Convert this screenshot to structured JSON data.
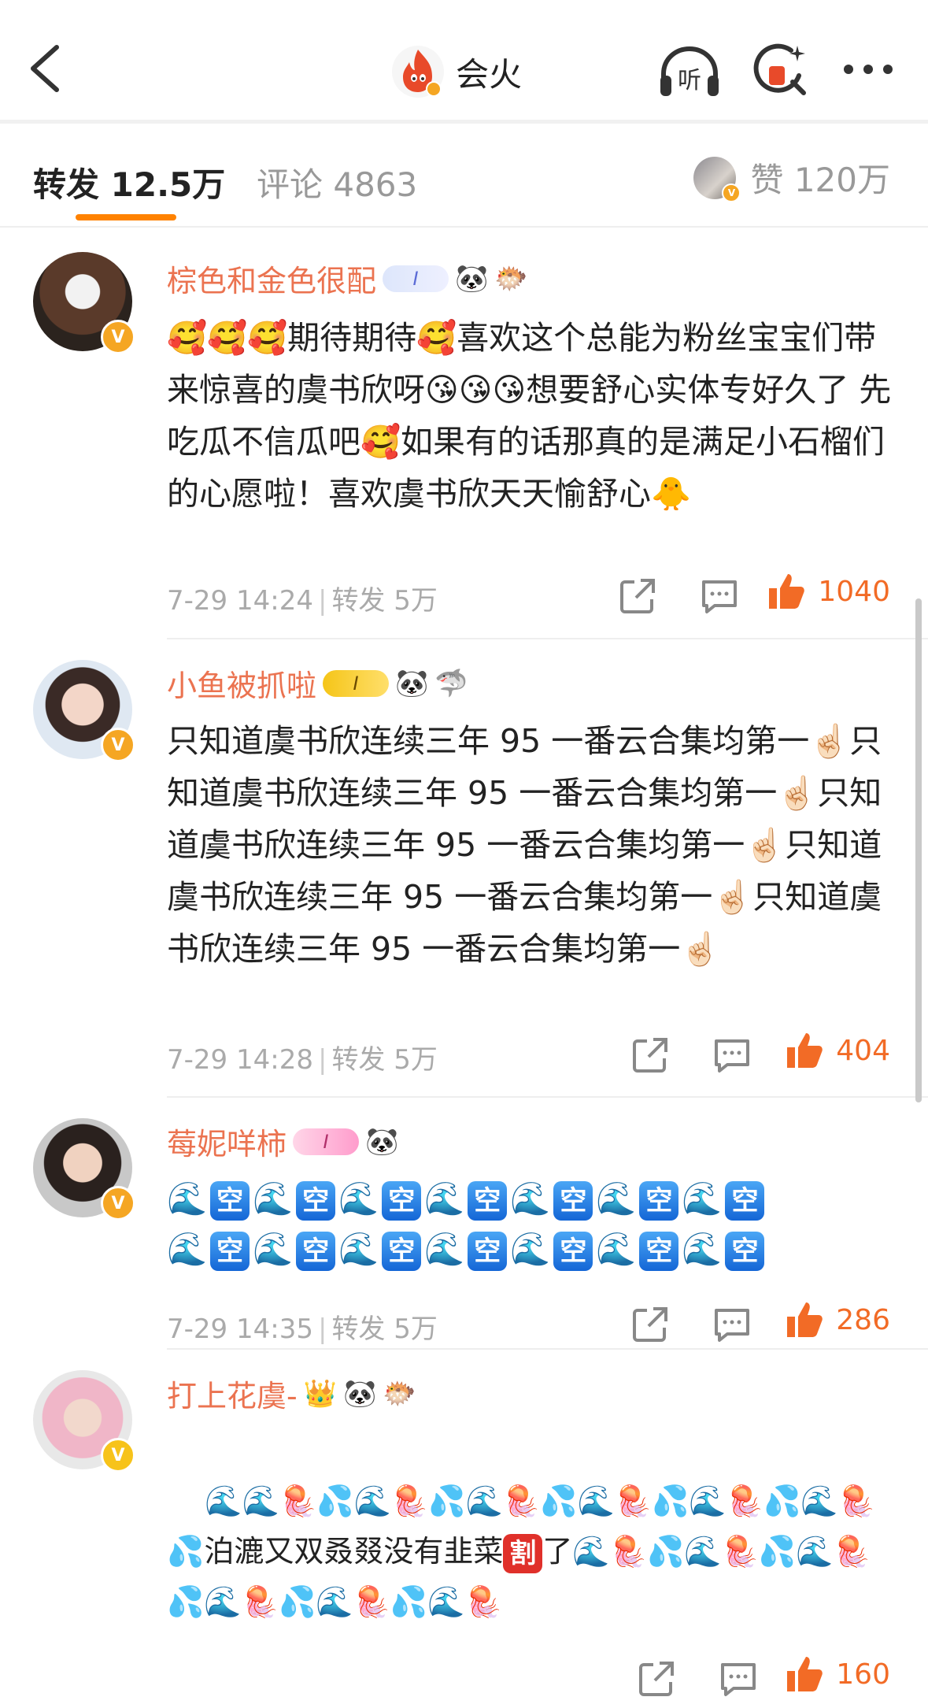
{
  "header": {
    "title": "会火",
    "back_icon": "chevron-left-icon",
    "listen_label": "听",
    "more_icon": "ellipsis-icon"
  },
  "tabs": [
    {
      "label": "转发 12.5万",
      "active": true
    },
    {
      "label": "评论 4863",
      "active": false
    }
  ],
  "likes_summary": "赞 120万",
  "comments": [
    {
      "username": "棕色和金色很配",
      "badges": [
        "🐼",
        "🐡"
      ],
      "level": "I",
      "text": "🥰🥰🥰期待期待🥰喜欢这个总能为粉丝宝宝们带来惊喜的虞书欣呀😘😘😘想要舒心实体专好久了 先吃瓜不信瓜吧🥰如果有的话那真的是满足小石榴们的心愿啦！喜欢虞书欣天天愉舒心🐥",
      "time": "7-29 14:24",
      "repost": "转发 5万",
      "likes": "1040",
      "verify": "V"
    },
    {
      "username": "小鱼被抓啦",
      "badges": [
        "🐼",
        "🦈"
      ],
      "level": "I",
      "text": "只知道虞书欣连续三年 95 一番云合集均第一☝🏻只知道虞书欣连续三年 95 一番云合集均第一☝🏻只知道虞书欣连续三年 95 一番云合集均第一☝🏻只知道虞书欣连续三年 95 一番云合集均第一☝🏻只知道虞书欣连续三年 95 一番云合集均第一☝🏻",
      "time": "7-29 14:28",
      "repost": "转发 5万",
      "likes": "404",
      "verify": "V"
    },
    {
      "username": "莓妮咩柿",
      "badges": [
        "🐼"
      ],
      "level": "I",
      "kong_rows": 2,
      "kong_text": "空",
      "time": "7-29 14:35",
      "repost": "转发 5万",
      "likes": "286",
      "verify": "V"
    },
    {
      "username": "打上花虞-",
      "badges": [
        "👑",
        "🐼",
        "🐡"
      ],
      "text_middle": "泊漉又双叒叕没有韭菜",
      "ge_text": "割",
      "text_tail": "了",
      "likes": "160",
      "verify": "V"
    }
  ]
}
